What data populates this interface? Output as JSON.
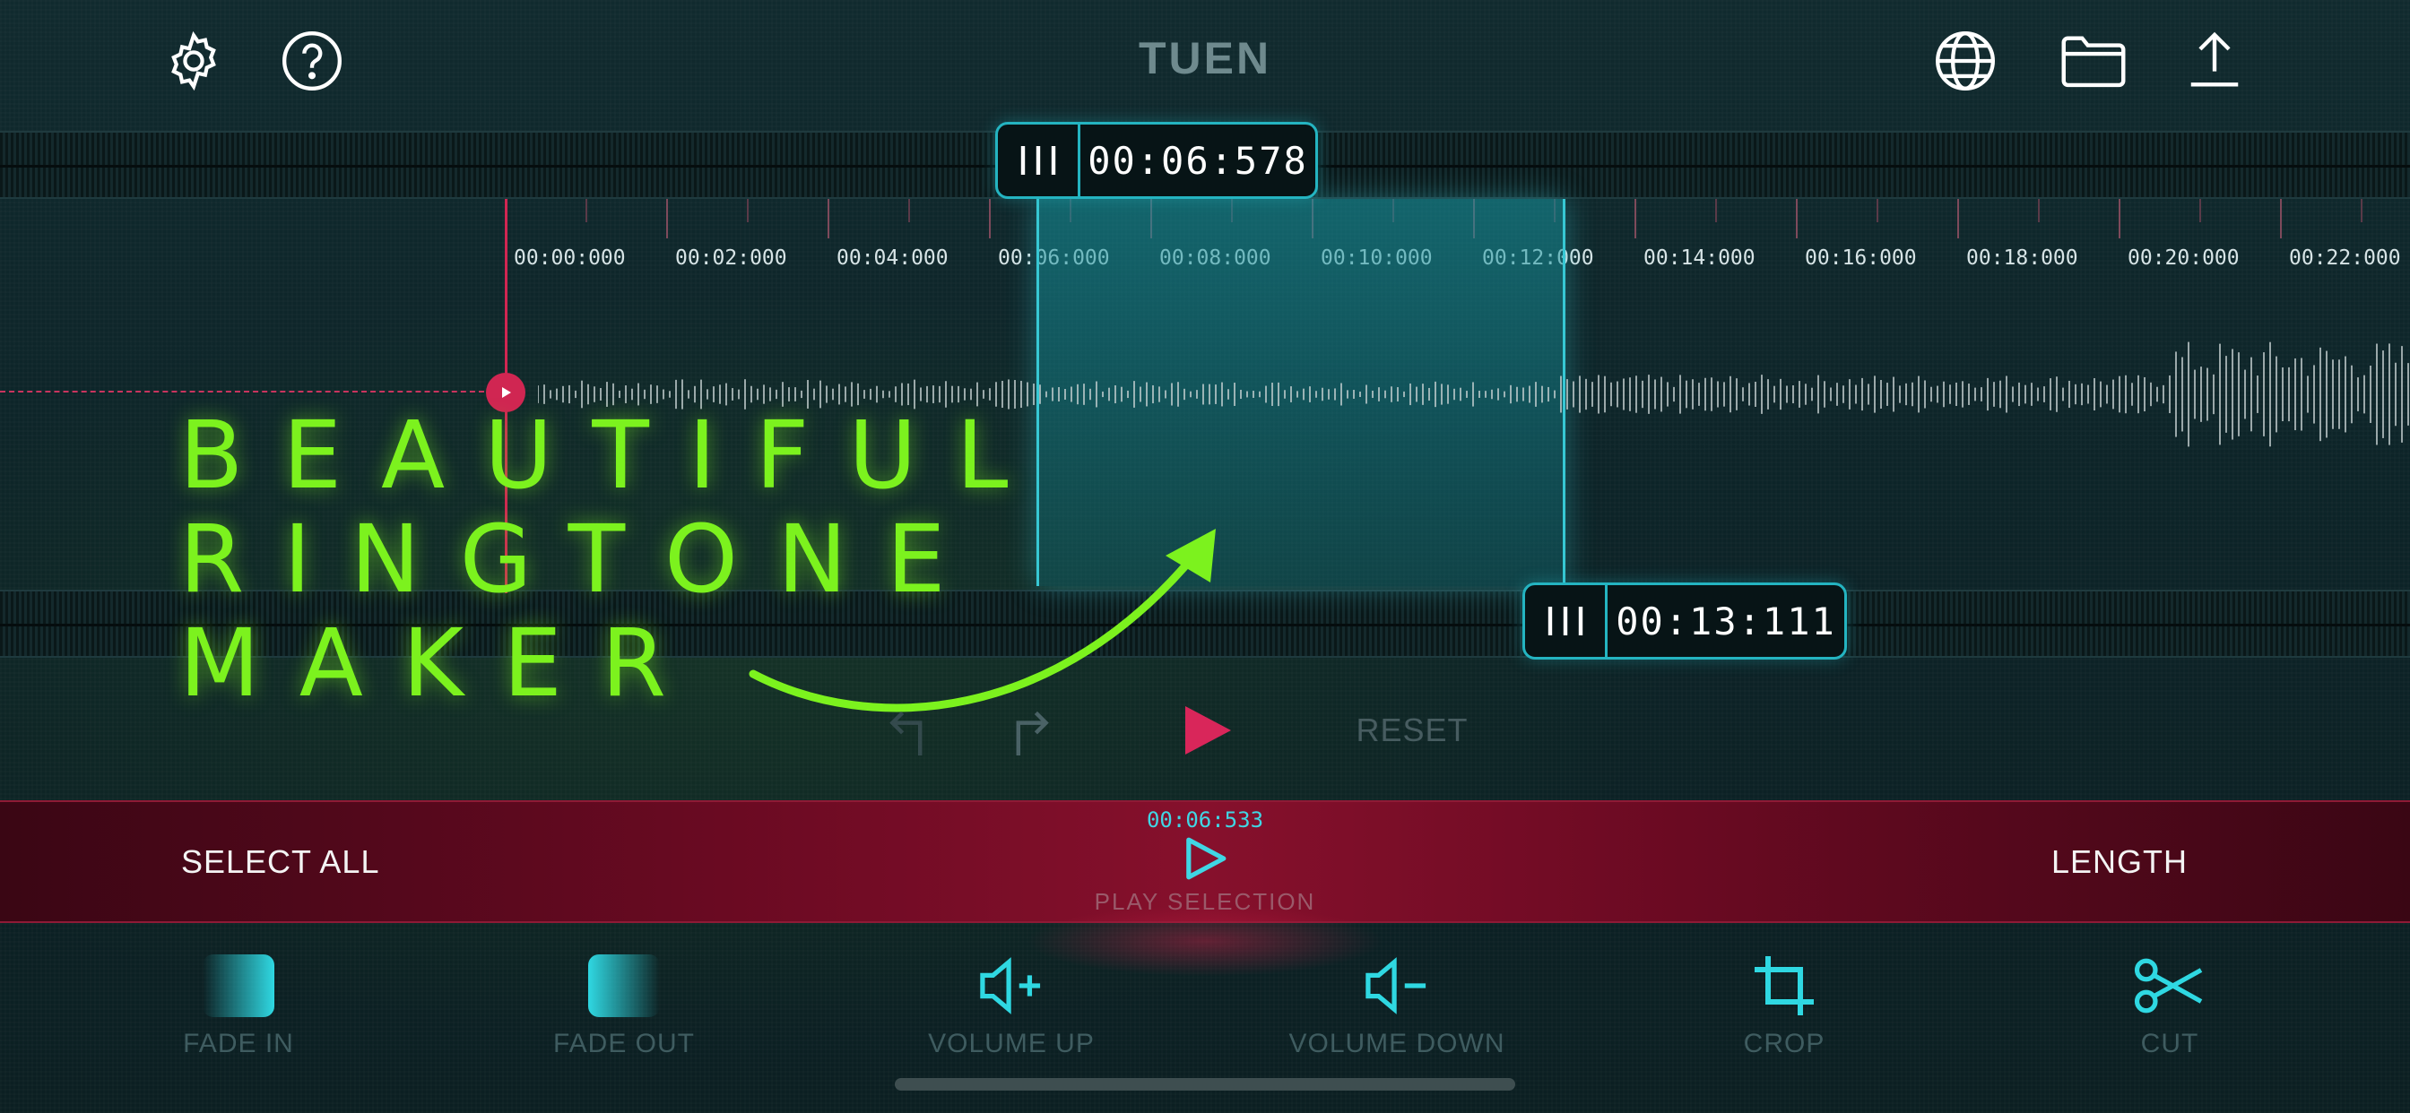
{
  "header": {
    "title": "TUEN",
    "icons": [
      "gear-icon",
      "help-icon",
      "globe-icon",
      "folder-icon",
      "share-icon"
    ]
  },
  "markers": {
    "start_time": "00:06:578",
    "end_time": "00:13:111"
  },
  "timeline": {
    "labels": [
      "00:00:000",
      "00:02:000",
      "00:04:000",
      "00:06:000",
      "00:08:000",
      "00:10:000",
      "00:12:000",
      "00:14:000",
      "00:16:000",
      "00:18:000",
      "00:20:000",
      "00:22:000"
    ]
  },
  "promo": {
    "line1": "BEAUTIFUL",
    "line2": "RINGTONE",
    "line3": "MAKER"
  },
  "controls": {
    "reset_label": "RESET"
  },
  "selection_bar": {
    "select_all_label": "SELECT ALL",
    "current_time": "00:06:533",
    "play_selection_label": "PLAY SELECTION",
    "length_label": "LENGTH"
  },
  "tools": [
    {
      "label": "FADE IN"
    },
    {
      "label": "FADE OUT"
    },
    {
      "label": "VOLUME UP"
    },
    {
      "label": "VOLUME DOWN"
    },
    {
      "label": "CROP"
    },
    {
      "label": "CUT"
    }
  ],
  "colors": {
    "accent_cyan": "#24b4c1",
    "accent_red": "#d02652",
    "promo_green": "#7cf21e"
  }
}
